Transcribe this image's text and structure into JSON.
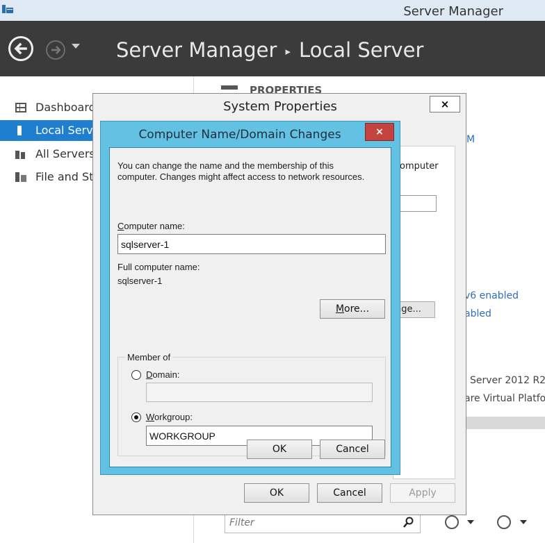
{
  "window": {
    "title": "Server Manager"
  },
  "header": {
    "app": "Server Manager",
    "separator": "▸",
    "page": "Local Server"
  },
  "sidebar": {
    "items": [
      {
        "label": "Dashboard",
        "icon": "dashboard-grid-icon",
        "active": false
      },
      {
        "label": "Local Server",
        "icon": "server-icon",
        "active": true
      },
      {
        "label": "All Servers",
        "icon": "servers-icon",
        "active": false
      },
      {
        "label": "File and Storage Services",
        "icon": "file-storage-icon",
        "active": false
      }
    ]
  },
  "background": {
    "properties_heading": "PROPERTIES",
    "partial_m": "M",
    "partial_computer": "omputer",
    "ipv6": "v6 enabled",
    "abled": "abled",
    "server_version": "Server 2012 R2",
    "virtual_platform": "are Virtual Platform",
    "filter_placeholder": "Filter"
  },
  "system_properties": {
    "title": "System Properties",
    "close": "×",
    "change_partial": "nge...",
    "ok": "OK",
    "cancel": "Cancel",
    "apply": "Apply"
  },
  "name_dialog": {
    "title": "Computer Name/Domain Changes",
    "close": "×",
    "description_line1": "You can change the name and the membership of this",
    "description_line2": "computer. Changes might affect access to network resources.",
    "computer_name_label_underlined": "C",
    "computer_name_label_rest": "omputer name:",
    "computer_name_value": "sqlserver-1",
    "full_name_label": "Full computer name:",
    "full_name_value": "sqlserver-1",
    "more_underlined": "M",
    "more_rest": "ore...",
    "member_of": "Member of",
    "domain_underlined": "D",
    "domain_rest": "omain:",
    "domain_value": "",
    "workgroup_underlined": "W",
    "workgroup_rest": "orkgroup:",
    "workgroup_value": "WORKGROUP",
    "selected": "workgroup",
    "ok": "OK",
    "cancel": "Cancel"
  },
  "colors": {
    "header_bg": "#3b3b3b",
    "active_nav": "#1e7fd1",
    "dialog_frame": "#63c2e4",
    "close_red": "#c3433e"
  }
}
